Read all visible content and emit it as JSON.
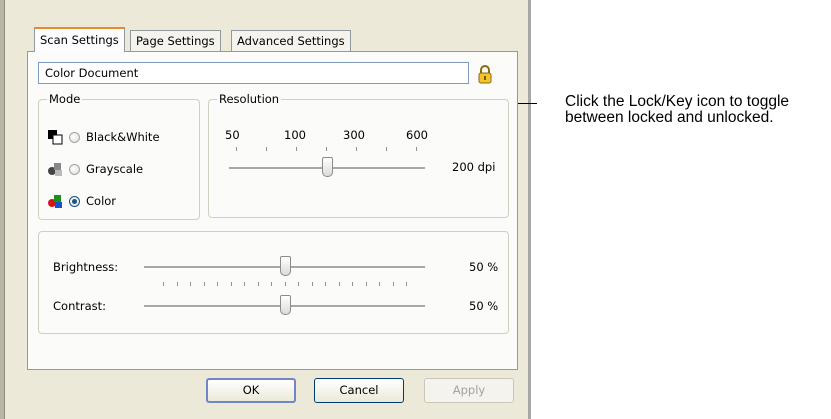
{
  "tabs": [
    {
      "label": "Scan Settings",
      "active": true
    },
    {
      "label": "Page Settings",
      "active": false
    },
    {
      "label": "Advanced Settings",
      "active": false
    }
  ],
  "preset_name": "Color Document",
  "lock_icon": "lock-key-icon",
  "mode": {
    "legend": "Mode",
    "options": [
      {
        "label": "Black&White",
        "icon": "black-white-mode-icon",
        "selected": false
      },
      {
        "label": "Grayscale",
        "icon": "grayscale-mode-icon",
        "selected": false
      },
      {
        "label": "Color",
        "icon": "color-mode-icon",
        "selected": true
      }
    ]
  },
  "resolution": {
    "legend": "Resolution",
    "scale_labels": [
      "50",
      "100",
      "300",
      "600"
    ],
    "value_text": "200 dpi",
    "value": 200,
    "position_fraction": 0.5
  },
  "brightness": {
    "label": "Brightness:",
    "value_text": "50 %",
    "value": 50
  },
  "contrast": {
    "label": "Contrast:",
    "value_text": "50 %",
    "value": 50
  },
  "buttons": {
    "ok": "OK",
    "cancel": "Cancel",
    "apply": "Apply"
  },
  "callout": "Click the Lock/Key icon to toggle between locked and unlocked.",
  "colors": {
    "active_tab_accent": "#e68b2c",
    "dialog_face": "#ece9d8"
  }
}
